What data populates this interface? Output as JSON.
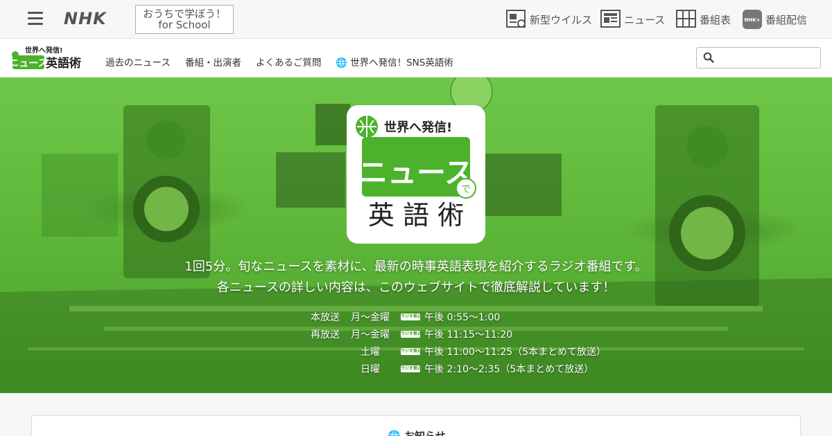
{
  "topbar": {
    "brand": "NHK",
    "school_line1": "おうちで学ぼう！",
    "school_line2": "for School",
    "nav": [
      {
        "label": "新型ウイルス",
        "icon": "virus-news-icon"
      },
      {
        "label": "ニュース",
        "icon": "news-icon"
      },
      {
        "label": "番組表",
        "icon": "program-table-icon"
      },
      {
        "label": "番組配信",
        "icon": "nhk-plus-icon"
      }
    ]
  },
  "program": {
    "logo_top": "世界へ発信!",
    "logo_main": "ニュース",
    "logo_sub": "英語術",
    "nav": [
      "過去のニュース",
      "番組・出演者",
      "よくあるご質問",
      "世界へ発信！SNS英語術"
    ]
  },
  "hero": {
    "card_top": "世界へ発信!",
    "card_main": "ニュース",
    "card_de": "で",
    "card_sub": "英 語 術",
    "line1": "1回5分。旬なニュースを素材に、最新の時事英語表現を紹介するラジオ番組です。",
    "line2": "各ニュースの詳しい内容は、このウェブサイトで徹底解説しています！",
    "schedule": [
      {
        "label": "本放送",
        "days": "月～金曜",
        "time": "午後  0:55～1:00"
      },
      {
        "label": "再放送",
        "days": "月～金曜",
        "time": "午後 11:15～11:20"
      },
      {
        "label": "土曜",
        "days": "",
        "time": "午後 11:00～11:25（5本まとめて放送）"
      },
      {
        "label": "日曜",
        "days": "",
        "time": "午後  2:10～2:35（5本まとめて放送）"
      }
    ],
    "channel_badge": "ラジオ第2"
  },
  "notice": {
    "title": "お知らせ"
  },
  "colors": {
    "accent": "#4cb22c",
    "hero_green": "#5fb83a"
  }
}
